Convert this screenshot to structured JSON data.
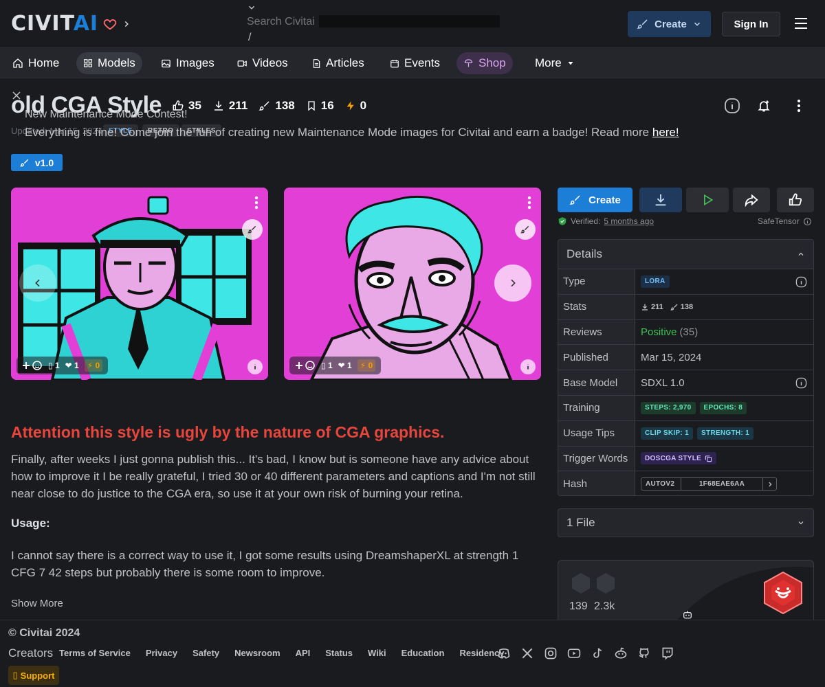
{
  "header": {
    "brand_civit": "CIVIT",
    "brand_ai": "AI",
    "search_placeholder": "Search Civitai",
    "search_shortcut": "/",
    "create_label": "Create",
    "signin_label": "Sign In"
  },
  "nav": [
    {
      "label": "Home",
      "icon": "home-icon"
    },
    {
      "label": "Models",
      "icon": "models-icon"
    },
    {
      "label": "Images",
      "icon": "images-icon"
    },
    {
      "label": "Videos",
      "icon": "video-icon"
    },
    {
      "label": "Articles",
      "icon": "article-icon"
    },
    {
      "label": "Events",
      "icon": "calendar-icon"
    },
    {
      "label": "Shop",
      "icon": "shop-icon"
    },
    {
      "label": "More",
      "icon": "caret-down-icon"
    }
  ],
  "model": {
    "title": "old CGA Style",
    "likes": "35",
    "downloads": "211",
    "generations": "138",
    "bookmarks": "16",
    "buzz": "0",
    "updated": "Updated: Mar 15, 2024",
    "tags": [
      "STYLE",
      "RETRO",
      "STYLES"
    ],
    "version": "v1.0"
  },
  "contest": {
    "title": "New Maintenance Mode Contest!",
    "body": "Everything is fine! Come join the fun of creating new Maintenance Mode images for Civitai and earn a badge! Read more",
    "link": "here!"
  },
  "gallery": [
    {
      "subject": "officer",
      "reactions": {
        "cry": "1",
        "heart": "1",
        "buzz": "0"
      }
    },
    {
      "subject": "old-man",
      "reactions": {
        "cry": "1",
        "heart": "1",
        "buzz": "0"
      }
    }
  ],
  "description": {
    "heading": "Attention this style is ugly by the nature of CGA graphics.",
    "paragraph1": "Finally, after weeks I just gonna publish this... It's bad, I know but is someone have any advice about how to improve it I be really grateful, I tried 30 or 40 different parameters and captions and I'm not still near close to do justice to the CGA era, so use it at your own risk of burning your retina.",
    "usage_label": "Usage:",
    "paragraph2": "I cannot say there is a correct way to use it, I got some results using DreamshaperXL at strength 1 CFG 7 42 steps but probably there is some room to improve.",
    "show_more": "Show More"
  },
  "sidebar": {
    "create_label": "Create",
    "verified_prefix": "Verified:",
    "verified_time": "5 months ago",
    "safetensor": "SafeTensor",
    "details_title": "Details",
    "rows": {
      "type_label": "Type",
      "type_value": "LORA",
      "stats_label": "Stats",
      "stats_downloads": "211",
      "stats_generations": "138",
      "reviews_label": "Reviews",
      "reviews_value": "Positive",
      "reviews_count": "(35)",
      "published_label": "Published",
      "published_value": "Mar 15, 2024",
      "base_label": "Base Model",
      "base_value": "SDXL 1.0",
      "training_label": "Training",
      "training_steps": "STEPS: 2,970",
      "training_epochs": "EPOCHS: 8",
      "tips_label": "Usage Tips",
      "tips_clip": "CLIP SKIP: 1",
      "tips_strength": "STRENGTH: 1",
      "trigger_label": "Trigger Words",
      "trigger_value": "DOSCGA STYLE",
      "hash_label": "Hash",
      "hash_type": "AUTOV2",
      "hash_value": "1F68EAE6AA"
    },
    "files_label": "1 File",
    "creator_stat1": "139",
    "creator_stat2": "2.3k"
  },
  "footer": {
    "copyright": "© Civitai 2024",
    "creators": "Creators",
    "links": [
      "Terms of Service",
      "Privacy",
      "Safety",
      "Newsroom",
      "API",
      "Status",
      "Wiki",
      "Education",
      "Residency"
    ],
    "support": "Support"
  },
  "colors": {
    "accent": "#1c7ed6",
    "heading_red": "#e8453c",
    "positive": "#40c057",
    "cga_magenta": "#e23fd6",
    "cga_cyan": "#3ee6e6"
  }
}
